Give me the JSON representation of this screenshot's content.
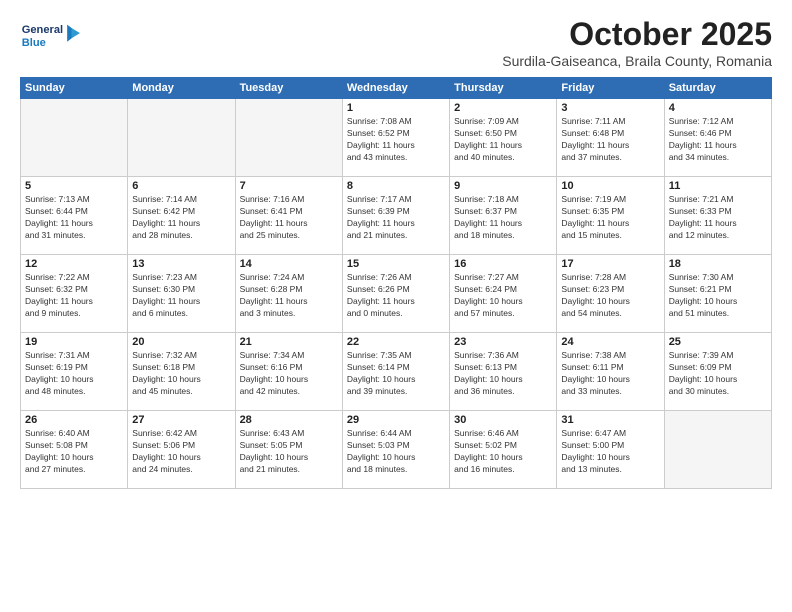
{
  "header": {
    "logo_line1": "General",
    "logo_line2": "Blue",
    "month": "October 2025",
    "location": "Surdila-Gaiseanca, Braila County, Romania"
  },
  "weekdays": [
    "Sunday",
    "Monday",
    "Tuesday",
    "Wednesday",
    "Thursday",
    "Friday",
    "Saturday"
  ],
  "weeks": [
    [
      {
        "day": "",
        "info": ""
      },
      {
        "day": "",
        "info": ""
      },
      {
        "day": "",
        "info": ""
      },
      {
        "day": "1",
        "info": "Sunrise: 7:08 AM\nSunset: 6:52 PM\nDaylight: 11 hours\nand 43 minutes."
      },
      {
        "day": "2",
        "info": "Sunrise: 7:09 AM\nSunset: 6:50 PM\nDaylight: 11 hours\nand 40 minutes."
      },
      {
        "day": "3",
        "info": "Sunrise: 7:11 AM\nSunset: 6:48 PM\nDaylight: 11 hours\nand 37 minutes."
      },
      {
        "day": "4",
        "info": "Sunrise: 7:12 AM\nSunset: 6:46 PM\nDaylight: 11 hours\nand 34 minutes."
      }
    ],
    [
      {
        "day": "5",
        "info": "Sunrise: 7:13 AM\nSunset: 6:44 PM\nDaylight: 11 hours\nand 31 minutes."
      },
      {
        "day": "6",
        "info": "Sunrise: 7:14 AM\nSunset: 6:42 PM\nDaylight: 11 hours\nand 28 minutes."
      },
      {
        "day": "7",
        "info": "Sunrise: 7:16 AM\nSunset: 6:41 PM\nDaylight: 11 hours\nand 25 minutes."
      },
      {
        "day": "8",
        "info": "Sunrise: 7:17 AM\nSunset: 6:39 PM\nDaylight: 11 hours\nand 21 minutes."
      },
      {
        "day": "9",
        "info": "Sunrise: 7:18 AM\nSunset: 6:37 PM\nDaylight: 11 hours\nand 18 minutes."
      },
      {
        "day": "10",
        "info": "Sunrise: 7:19 AM\nSunset: 6:35 PM\nDaylight: 11 hours\nand 15 minutes."
      },
      {
        "day": "11",
        "info": "Sunrise: 7:21 AM\nSunset: 6:33 PM\nDaylight: 11 hours\nand 12 minutes."
      }
    ],
    [
      {
        "day": "12",
        "info": "Sunrise: 7:22 AM\nSunset: 6:32 PM\nDaylight: 11 hours\nand 9 minutes."
      },
      {
        "day": "13",
        "info": "Sunrise: 7:23 AM\nSunset: 6:30 PM\nDaylight: 11 hours\nand 6 minutes."
      },
      {
        "day": "14",
        "info": "Sunrise: 7:24 AM\nSunset: 6:28 PM\nDaylight: 11 hours\nand 3 minutes."
      },
      {
        "day": "15",
        "info": "Sunrise: 7:26 AM\nSunset: 6:26 PM\nDaylight: 11 hours\nand 0 minutes."
      },
      {
        "day": "16",
        "info": "Sunrise: 7:27 AM\nSunset: 6:24 PM\nDaylight: 10 hours\nand 57 minutes."
      },
      {
        "day": "17",
        "info": "Sunrise: 7:28 AM\nSunset: 6:23 PM\nDaylight: 10 hours\nand 54 minutes."
      },
      {
        "day": "18",
        "info": "Sunrise: 7:30 AM\nSunset: 6:21 PM\nDaylight: 10 hours\nand 51 minutes."
      }
    ],
    [
      {
        "day": "19",
        "info": "Sunrise: 7:31 AM\nSunset: 6:19 PM\nDaylight: 10 hours\nand 48 minutes."
      },
      {
        "day": "20",
        "info": "Sunrise: 7:32 AM\nSunset: 6:18 PM\nDaylight: 10 hours\nand 45 minutes."
      },
      {
        "day": "21",
        "info": "Sunrise: 7:34 AM\nSunset: 6:16 PM\nDaylight: 10 hours\nand 42 minutes."
      },
      {
        "day": "22",
        "info": "Sunrise: 7:35 AM\nSunset: 6:14 PM\nDaylight: 10 hours\nand 39 minutes."
      },
      {
        "day": "23",
        "info": "Sunrise: 7:36 AM\nSunset: 6:13 PM\nDaylight: 10 hours\nand 36 minutes."
      },
      {
        "day": "24",
        "info": "Sunrise: 7:38 AM\nSunset: 6:11 PM\nDaylight: 10 hours\nand 33 minutes."
      },
      {
        "day": "25",
        "info": "Sunrise: 7:39 AM\nSunset: 6:09 PM\nDaylight: 10 hours\nand 30 minutes."
      }
    ],
    [
      {
        "day": "26",
        "info": "Sunrise: 6:40 AM\nSunset: 5:08 PM\nDaylight: 10 hours\nand 27 minutes."
      },
      {
        "day": "27",
        "info": "Sunrise: 6:42 AM\nSunset: 5:06 PM\nDaylight: 10 hours\nand 24 minutes."
      },
      {
        "day": "28",
        "info": "Sunrise: 6:43 AM\nSunset: 5:05 PM\nDaylight: 10 hours\nand 21 minutes."
      },
      {
        "day": "29",
        "info": "Sunrise: 6:44 AM\nSunset: 5:03 PM\nDaylight: 10 hours\nand 18 minutes."
      },
      {
        "day": "30",
        "info": "Sunrise: 6:46 AM\nSunset: 5:02 PM\nDaylight: 10 hours\nand 16 minutes."
      },
      {
        "day": "31",
        "info": "Sunrise: 6:47 AM\nSunset: 5:00 PM\nDaylight: 10 hours\nand 13 minutes."
      },
      {
        "day": "",
        "info": ""
      }
    ]
  ]
}
